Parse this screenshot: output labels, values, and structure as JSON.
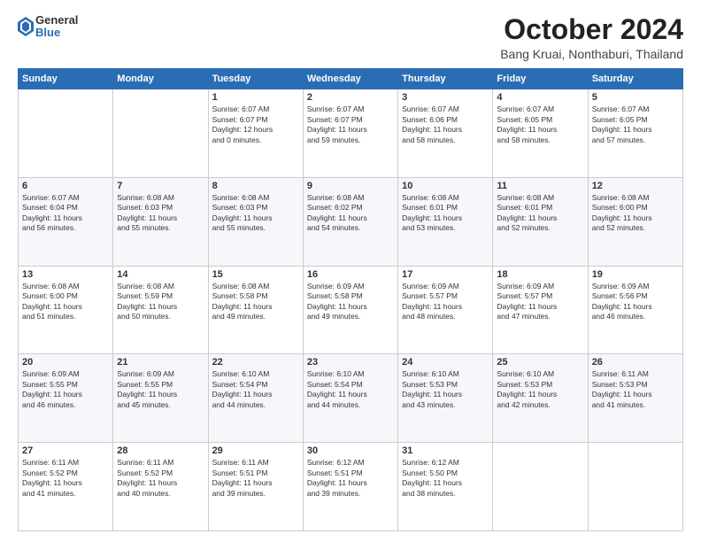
{
  "header": {
    "logo": {
      "general": "General",
      "blue": "Blue"
    },
    "title": "October 2024",
    "location": "Bang Kruai, Nonthaburi, Thailand"
  },
  "calendar": {
    "days_of_week": [
      "Sunday",
      "Monday",
      "Tuesday",
      "Wednesday",
      "Thursday",
      "Friday",
      "Saturday"
    ],
    "weeks": [
      [
        {
          "day": "",
          "info": ""
        },
        {
          "day": "",
          "info": ""
        },
        {
          "day": "1",
          "info": "Sunrise: 6:07 AM\nSunset: 6:07 PM\nDaylight: 12 hours\nand 0 minutes."
        },
        {
          "day": "2",
          "info": "Sunrise: 6:07 AM\nSunset: 6:07 PM\nDaylight: 11 hours\nand 59 minutes."
        },
        {
          "day": "3",
          "info": "Sunrise: 6:07 AM\nSunset: 6:06 PM\nDaylight: 11 hours\nand 58 minutes."
        },
        {
          "day": "4",
          "info": "Sunrise: 6:07 AM\nSunset: 6:05 PM\nDaylight: 11 hours\nand 58 minutes."
        },
        {
          "day": "5",
          "info": "Sunrise: 6:07 AM\nSunset: 6:05 PM\nDaylight: 11 hours\nand 57 minutes."
        }
      ],
      [
        {
          "day": "6",
          "info": "Sunrise: 6:07 AM\nSunset: 6:04 PM\nDaylight: 11 hours\nand 56 minutes."
        },
        {
          "day": "7",
          "info": "Sunrise: 6:08 AM\nSunset: 6:03 PM\nDaylight: 11 hours\nand 55 minutes."
        },
        {
          "day": "8",
          "info": "Sunrise: 6:08 AM\nSunset: 6:03 PM\nDaylight: 11 hours\nand 55 minutes."
        },
        {
          "day": "9",
          "info": "Sunrise: 6:08 AM\nSunset: 6:02 PM\nDaylight: 11 hours\nand 54 minutes."
        },
        {
          "day": "10",
          "info": "Sunrise: 6:08 AM\nSunset: 6:01 PM\nDaylight: 11 hours\nand 53 minutes."
        },
        {
          "day": "11",
          "info": "Sunrise: 6:08 AM\nSunset: 6:01 PM\nDaylight: 11 hours\nand 52 minutes."
        },
        {
          "day": "12",
          "info": "Sunrise: 6:08 AM\nSunset: 6:00 PM\nDaylight: 11 hours\nand 52 minutes."
        }
      ],
      [
        {
          "day": "13",
          "info": "Sunrise: 6:08 AM\nSunset: 6:00 PM\nDaylight: 11 hours\nand 51 minutes."
        },
        {
          "day": "14",
          "info": "Sunrise: 6:08 AM\nSunset: 5:59 PM\nDaylight: 11 hours\nand 50 minutes."
        },
        {
          "day": "15",
          "info": "Sunrise: 6:08 AM\nSunset: 5:58 PM\nDaylight: 11 hours\nand 49 minutes."
        },
        {
          "day": "16",
          "info": "Sunrise: 6:09 AM\nSunset: 5:58 PM\nDaylight: 11 hours\nand 49 minutes."
        },
        {
          "day": "17",
          "info": "Sunrise: 6:09 AM\nSunset: 5:57 PM\nDaylight: 11 hours\nand 48 minutes."
        },
        {
          "day": "18",
          "info": "Sunrise: 6:09 AM\nSunset: 5:57 PM\nDaylight: 11 hours\nand 47 minutes."
        },
        {
          "day": "19",
          "info": "Sunrise: 6:09 AM\nSunset: 5:56 PM\nDaylight: 11 hours\nand 46 minutes."
        }
      ],
      [
        {
          "day": "20",
          "info": "Sunrise: 6:09 AM\nSunset: 5:55 PM\nDaylight: 11 hours\nand 46 minutes."
        },
        {
          "day": "21",
          "info": "Sunrise: 6:09 AM\nSunset: 5:55 PM\nDaylight: 11 hours\nand 45 minutes."
        },
        {
          "day": "22",
          "info": "Sunrise: 6:10 AM\nSunset: 5:54 PM\nDaylight: 11 hours\nand 44 minutes."
        },
        {
          "day": "23",
          "info": "Sunrise: 6:10 AM\nSunset: 5:54 PM\nDaylight: 11 hours\nand 44 minutes."
        },
        {
          "day": "24",
          "info": "Sunrise: 6:10 AM\nSunset: 5:53 PM\nDaylight: 11 hours\nand 43 minutes."
        },
        {
          "day": "25",
          "info": "Sunrise: 6:10 AM\nSunset: 5:53 PM\nDaylight: 11 hours\nand 42 minutes."
        },
        {
          "day": "26",
          "info": "Sunrise: 6:11 AM\nSunset: 5:53 PM\nDaylight: 11 hours\nand 41 minutes."
        }
      ],
      [
        {
          "day": "27",
          "info": "Sunrise: 6:11 AM\nSunset: 5:52 PM\nDaylight: 11 hours\nand 41 minutes."
        },
        {
          "day": "28",
          "info": "Sunrise: 6:11 AM\nSunset: 5:52 PM\nDaylight: 11 hours\nand 40 minutes."
        },
        {
          "day": "29",
          "info": "Sunrise: 6:11 AM\nSunset: 5:51 PM\nDaylight: 11 hours\nand 39 minutes."
        },
        {
          "day": "30",
          "info": "Sunrise: 6:12 AM\nSunset: 5:51 PM\nDaylight: 11 hours\nand 39 minutes."
        },
        {
          "day": "31",
          "info": "Sunrise: 6:12 AM\nSunset: 5:50 PM\nDaylight: 11 hours\nand 38 minutes."
        },
        {
          "day": "",
          "info": ""
        },
        {
          "day": "",
          "info": ""
        }
      ]
    ]
  }
}
